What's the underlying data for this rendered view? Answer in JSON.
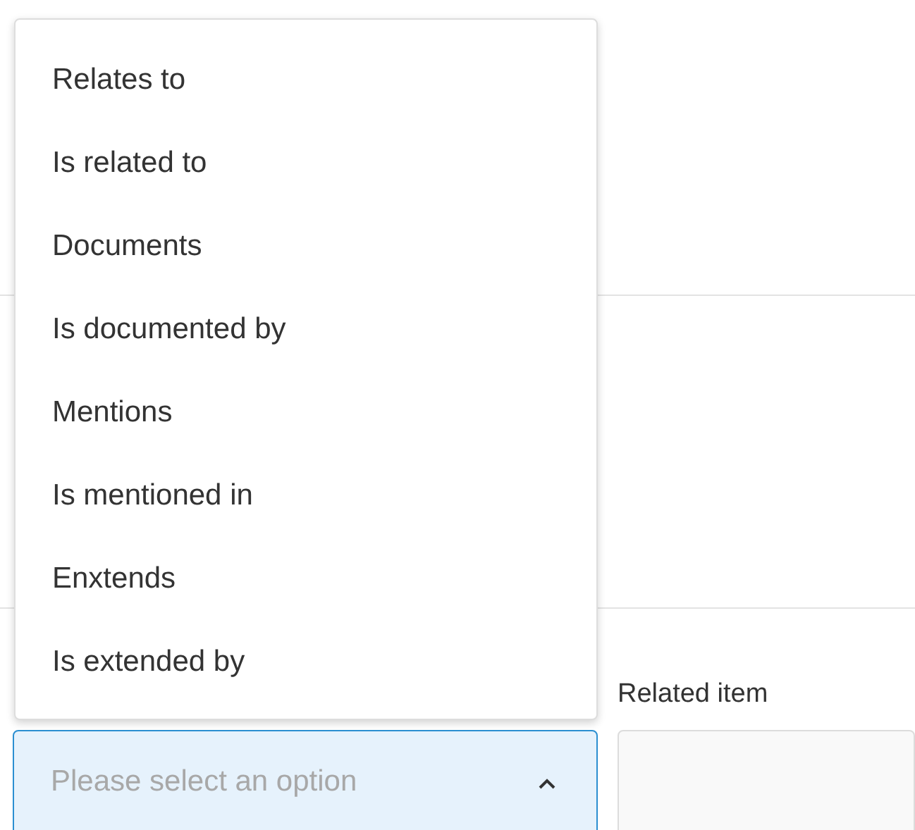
{
  "relation_select": {
    "placeholder": "Please select an option",
    "expanded": true,
    "options": [
      {
        "label": "Relates to"
      },
      {
        "label": "Is related to"
      },
      {
        "label": "Documents"
      },
      {
        "label": "Is documented by"
      },
      {
        "label": "Mentions"
      },
      {
        "label": "Is mentioned in"
      },
      {
        "label": "Enxtends"
      },
      {
        "label": "Is extended by"
      }
    ]
  },
  "related_item": {
    "label": "Related item"
  }
}
